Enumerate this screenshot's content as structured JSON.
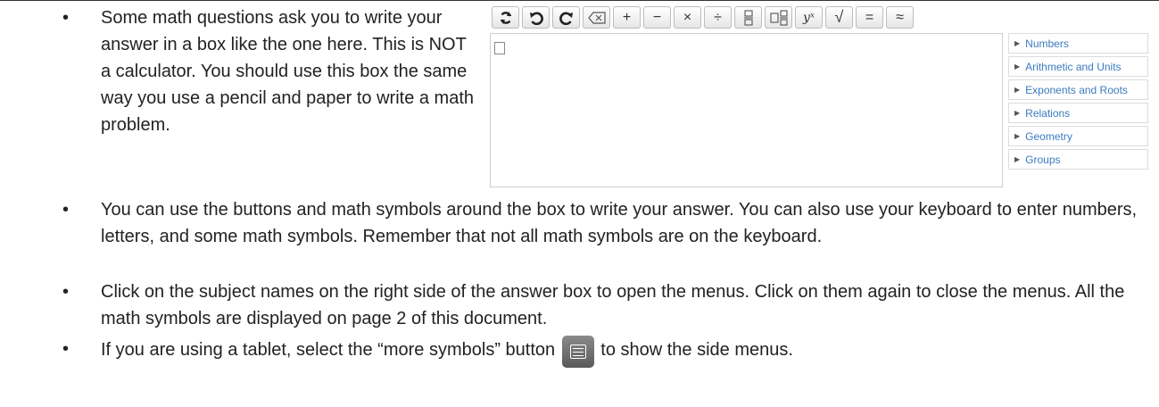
{
  "bullet_char": "•",
  "paragraphs": {
    "p1": "Some math questions ask you to write your answer in a box like the one here. This is NOT a calculator. You should use this box the same way you use a pencil and paper to write a math problem.",
    "p2": "You can use the buttons and math symbols around the box to write your answer. You can also use your keyboard to enter numbers, letters, and some math symbols. Remember that not all math symbols are on the keyboard.",
    "p3": "Click on the subject names on the right side of the answer box to open the menus. Click on them again to close the menus. All the math symbols are displayed on page 2 of this document.",
    "p4_before": "If you are using a tablet, select the “more symbols” button",
    "p4_after": "to show the side menus."
  },
  "toolbar": {
    "buttons": [
      {
        "name": "reload-icon",
        "label": ""
      },
      {
        "name": "undo-icon",
        "label": ""
      },
      {
        "name": "redo-icon",
        "label": ""
      },
      {
        "name": "backspace-icon",
        "label": ""
      },
      {
        "name": "plus",
        "label": "+"
      },
      {
        "name": "minus",
        "label": "−"
      },
      {
        "name": "times",
        "label": "×"
      },
      {
        "name": "divide",
        "label": "÷"
      },
      {
        "name": "fraction-icon",
        "label": ""
      },
      {
        "name": "mixed-fraction-icon",
        "label": ""
      },
      {
        "name": "exponent",
        "label": "yˣ"
      },
      {
        "name": "sqrt",
        "label": "√"
      },
      {
        "name": "equals",
        "label": "="
      },
      {
        "name": "approx",
        "label": "≈"
      }
    ]
  },
  "menu": {
    "items": [
      "Numbers",
      "Arithmetic and Units",
      "Exponents and Roots",
      "Relations",
      "Geometry",
      "Groups"
    ]
  }
}
